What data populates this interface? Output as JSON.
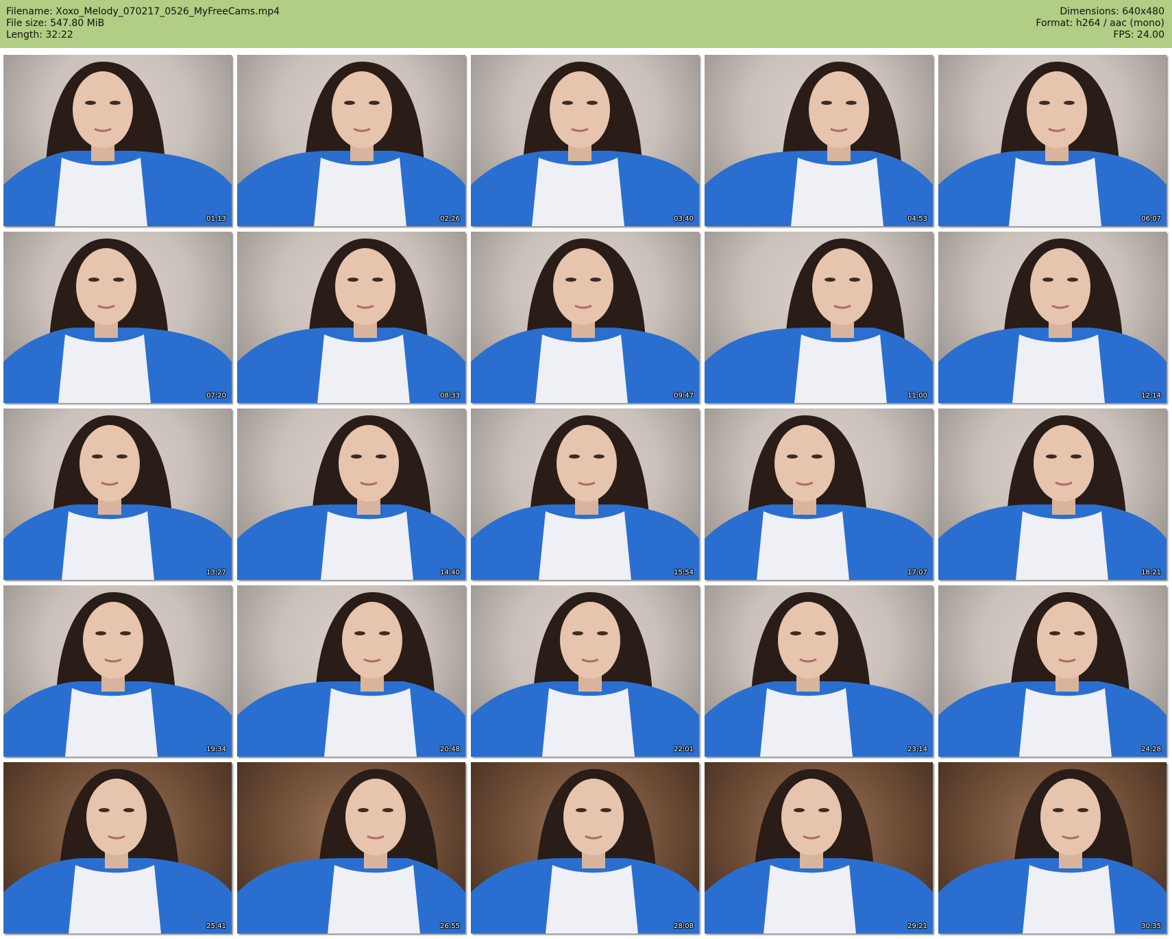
{
  "header": {
    "filename": "Filename: Xoxo_Melody_070217_0526_MyFreeCams.mp4",
    "file_size": "File size: 547.80 MiB",
    "length": "Length: 32:22",
    "dimensions": "Dimensions: 640x480",
    "format": "Format: h264 / aac (mono)",
    "fps": "FPS: 24.00"
  },
  "colors": {
    "header_bg": "#b2cd84",
    "shirt_blue": "#2a6fd0",
    "shirt_white": "#eef0f6",
    "hair": "#2a1c16",
    "wall_light": "#c9c1ba",
    "wall_dark": "#6b4a34"
  },
  "thumbnails": [
    {
      "time": "01:13"
    },
    {
      "time": "02:26"
    },
    {
      "time": "03:40"
    },
    {
      "time": "04:53"
    },
    {
      "time": "06:07"
    },
    {
      "time": "07:20"
    },
    {
      "time": "08:33"
    },
    {
      "time": "09:47"
    },
    {
      "time": "11:00"
    },
    {
      "time": "12:14"
    },
    {
      "time": "13:27"
    },
    {
      "time": "14:40"
    },
    {
      "time": "15:54"
    },
    {
      "time": "17:07"
    },
    {
      "time": "18:21"
    },
    {
      "time": "19:34"
    },
    {
      "time": "20:48"
    },
    {
      "time": "22:01"
    },
    {
      "time": "23:14"
    },
    {
      "time": "24:28"
    },
    {
      "time": "25:41"
    },
    {
      "time": "26:55"
    },
    {
      "time": "28:08"
    },
    {
      "time": "29:21"
    },
    {
      "time": "30:35"
    }
  ]
}
